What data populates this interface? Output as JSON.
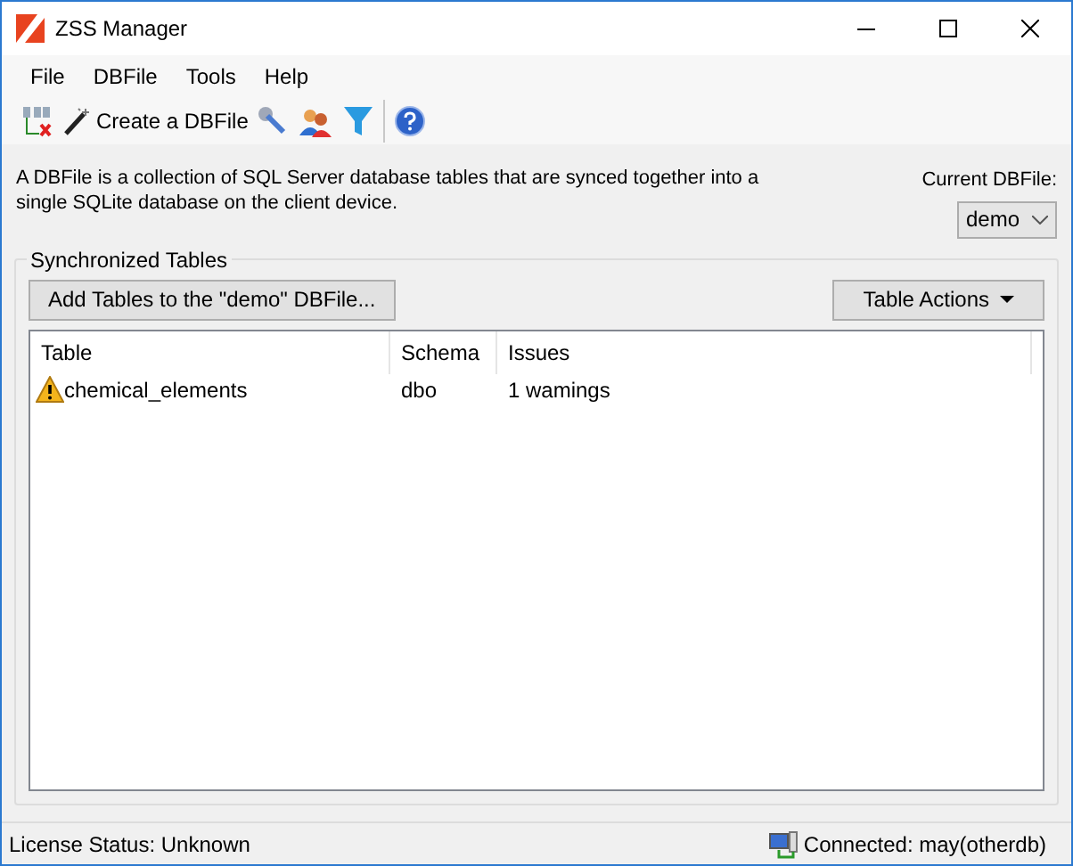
{
  "window": {
    "title": "ZSS Manager"
  },
  "menu": [
    "File",
    "DBFile",
    "Tools",
    "Help"
  ],
  "toolbar": {
    "create_label": "Create a DBFile"
  },
  "description": "A DBFile is a collection of SQL Server database tables that are synced together into a single SQLite database on the client device.",
  "current_dbfile": {
    "label": "Current DBFile:",
    "value": "demo"
  },
  "group": {
    "title": "Synchronized Tables",
    "add_button": "Add Tables to the \"demo\" DBFile...",
    "actions_button": "Table Actions"
  },
  "table": {
    "columns": [
      "Table",
      "Schema",
      "Issues"
    ],
    "rows": [
      {
        "cells": [
          "chemical_elements",
          "dbo",
          "1 wamings"
        ],
        "warning": true
      }
    ]
  },
  "status_bar": {
    "license": "License Status: Unknown",
    "connection": "Connected: may(otherdb)"
  }
}
